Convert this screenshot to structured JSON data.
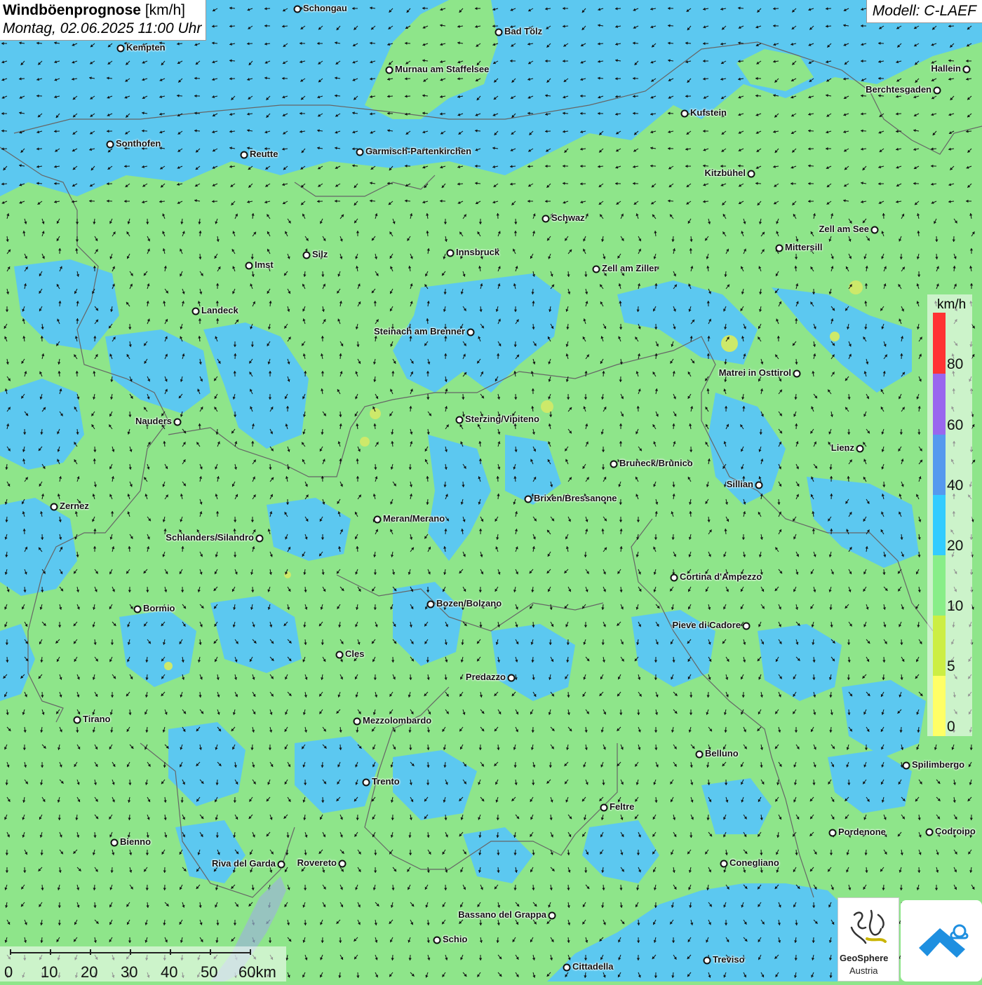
{
  "header": {
    "title_bold": "Windböenprognose",
    "title_unit": "[km/h]",
    "datetime": "Montag, 02.06.2025 11:00 Uhr"
  },
  "model": "Modell: C-LAEF",
  "legend": {
    "unit": "km/h",
    "labels": [
      "80",
      "60",
      "40",
      "20",
      "10",
      "5",
      "0"
    ],
    "colors": {
      "red": "#ff3333",
      "purple": "#9966ee",
      "blue": "#5599ee",
      "cyan": "#33ccff",
      "green": "#88ee88",
      "lime": "#ccee44",
      "yellow": "#ffff66"
    }
  },
  "scale": {
    "labels": [
      "0",
      "10",
      "20",
      "30",
      "40",
      "50",
      "60km"
    ]
  },
  "cities": [
    {
      "name": "Schongau"
    },
    {
      "name": "Bad Tölz"
    },
    {
      "name": "Kempten"
    },
    {
      "name": "Murnau am Staffelsee"
    },
    {
      "name": "Hallein"
    },
    {
      "name": "Berchtesgaden"
    },
    {
      "name": "Kufstein"
    },
    {
      "name": "Sonthofen"
    },
    {
      "name": "Reutte"
    },
    {
      "name": "Garmisch-Partenkirchen"
    },
    {
      "name": "Kitzbühel"
    },
    {
      "name": "Schwaz"
    },
    {
      "name": "Zell am See"
    },
    {
      "name": "Innsbruck"
    },
    {
      "name": "Mittersill"
    },
    {
      "name": "Silz"
    },
    {
      "name": "Imst"
    },
    {
      "name": "Zell am Ziller"
    },
    {
      "name": "Landeck"
    },
    {
      "name": "Steinach am Brenner"
    },
    {
      "name": "Matrei in Osttirol"
    },
    {
      "name": "Nauders"
    },
    {
      "name": "Sterzing/Vipiteno"
    },
    {
      "name": "Lienz"
    },
    {
      "name": "Bruneck/Brunico"
    },
    {
      "name": "Sillian"
    },
    {
      "name": "Zernez"
    },
    {
      "name": "Brixen/Bressanone"
    },
    {
      "name": "Meran/Merano"
    },
    {
      "name": "Schlanders/Silandro"
    },
    {
      "name": "Cortina d'Ampezzo"
    },
    {
      "name": "Bozen/Bolzano"
    },
    {
      "name": "Bormio"
    },
    {
      "name": "Pieve di Cadore"
    },
    {
      "name": "Cles"
    },
    {
      "name": "Predazzo"
    },
    {
      "name": "Tirano"
    },
    {
      "name": "Mezzolombardo"
    },
    {
      "name": "Belluno"
    },
    {
      "name": "Spilimbergo"
    },
    {
      "name": "Trento"
    },
    {
      "name": "Feltre"
    },
    {
      "name": "Pordenone"
    },
    {
      "name": "Codroipo"
    },
    {
      "name": "Bienno"
    },
    {
      "name": "Riva del Garda"
    },
    {
      "name": "Rovereto"
    },
    {
      "name": "Conegliano"
    },
    {
      "name": "Bassano del Grappa"
    },
    {
      "name": "Schio"
    },
    {
      "name": "Treviso"
    },
    {
      "name": "Cittadella"
    }
  ],
  "logo": {
    "line1": "GeoSphere",
    "line2": "Austria"
  }
}
